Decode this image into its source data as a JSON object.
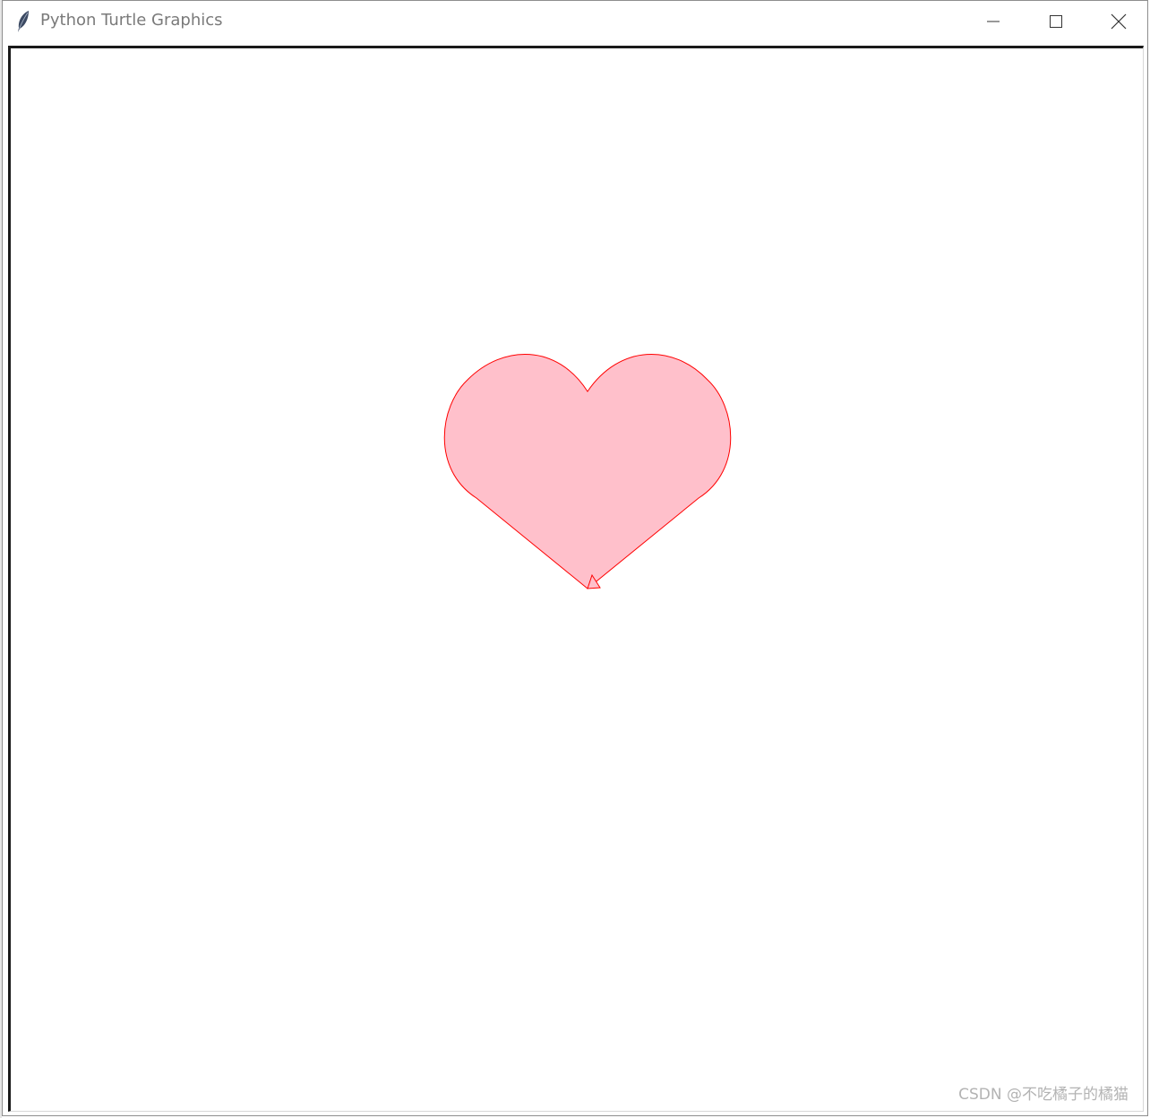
{
  "window": {
    "title": "Python Turtle Graphics"
  },
  "icons": {
    "app": "feather-icon",
    "minimize": "minimize-icon",
    "maximize": "maximize-icon",
    "close": "close-icon",
    "turtle": "arrow-cursor-icon"
  },
  "colors": {
    "heart_fill": "#ffc0cb",
    "heart_outline": "#ff0000",
    "canvas_background": "#ffffff"
  },
  "watermark": "CSDN @不吃橘子的橘猫"
}
